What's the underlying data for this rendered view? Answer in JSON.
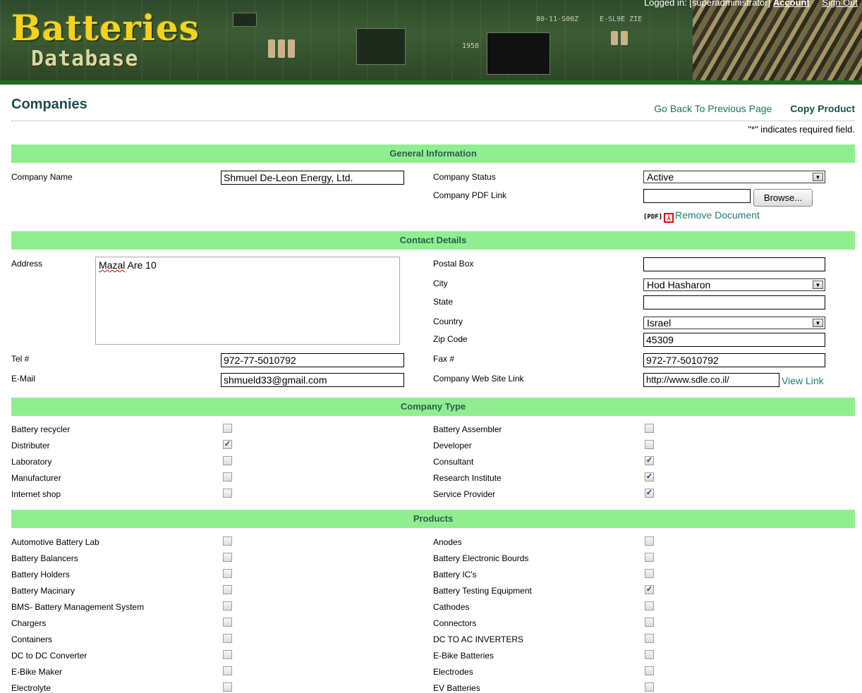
{
  "header": {
    "logo_line1": "Batteries",
    "logo_line2": "Database",
    "logged_in_text": "Logged in: [superadministrator]",
    "account_link": "Account",
    "signout_link": "Sign Out"
  },
  "page": {
    "title": "Companies",
    "back_link": "Go Back To Previous Page",
    "copy_link": "Copy Product",
    "required_note": "\"*\" indicates required field."
  },
  "general": {
    "heading": "General Information",
    "company_name_label": "Company Name",
    "company_name_value": "Shmuel De-Leon Energy, Ltd.",
    "status_label": "Company Status",
    "status_value": "Active",
    "pdf_label": "Company PDF Link",
    "browse_label": "Browse...",
    "pdf_tag": "[PDF]",
    "remove_doc": "Remove Document"
  },
  "contact": {
    "heading": "Contact Details",
    "address_label": "Address",
    "address_word1": "Mazal",
    "address_rest": " Are 10",
    "postal_label": "Postal Box",
    "postal_value": "",
    "city_label": "City",
    "city_value": "Hod Hasharon",
    "state_label": "State",
    "state_value": "",
    "country_label": "Country",
    "country_value": "Israel",
    "zip_label": "Zip Code",
    "zip_value": "45309",
    "tel_label": "Tel #",
    "tel_value": "972-77-5010792",
    "fax_label": "Fax #",
    "fax_value": "972-77-5010792",
    "email_label": "E-Mail",
    "email_value": "shmueld33@gmail.com",
    "web_label": "Company Web Site Link",
    "web_value": "http://www.sdle.co.il/",
    "view_link": "View Link"
  },
  "company_type": {
    "heading": "Company Type",
    "left": [
      {
        "label": "Battery recycler",
        "checked": false
      },
      {
        "label": "Distributer",
        "checked": true
      },
      {
        "label": "Laboratory",
        "checked": false
      },
      {
        "label": "Manufacturer",
        "checked": false
      },
      {
        "label": "Internet shop",
        "checked": false
      }
    ],
    "right": [
      {
        "label": "Battery Assembler",
        "checked": false
      },
      {
        "label": "Developer",
        "checked": false
      },
      {
        "label": "Consultant",
        "checked": true
      },
      {
        "label": "Research Institute",
        "checked": true
      },
      {
        "label": "Service Provider",
        "checked": true
      }
    ]
  },
  "products": {
    "heading": "Products",
    "left": [
      {
        "label": "Automotive Battery Lab",
        "checked": false
      },
      {
        "label": "Battery Balancers",
        "checked": false
      },
      {
        "label": "Battery Holders",
        "checked": false
      },
      {
        "label": "Battery Macinary",
        "checked": false
      },
      {
        "label": "BMS- Battery Management System",
        "checked": false
      },
      {
        "label": "Chargers",
        "checked": false
      },
      {
        "label": "Containers",
        "checked": false
      },
      {
        "label": "DC to DC Converter",
        "checked": false
      },
      {
        "label": "E-Bike Maker",
        "checked": false
      },
      {
        "label": "Electrolyte",
        "checked": false
      }
    ],
    "right": [
      {
        "label": "Anodes",
        "checked": false
      },
      {
        "label": "Battery Electronic Bourds",
        "checked": false
      },
      {
        "label": "Battery IC's",
        "checked": false
      },
      {
        "label": "Battery Testing Equipment",
        "checked": true
      },
      {
        "label": "Cathodes",
        "checked": false
      },
      {
        "label": "Connectors",
        "checked": false
      },
      {
        "label": "DC TO AC INVERTERS",
        "checked": false
      },
      {
        "label": "E-Bike Batteries",
        "checked": false
      },
      {
        "label": "Electrodes",
        "checked": false
      },
      {
        "label": "EV Batteries",
        "checked": false
      }
    ]
  },
  "colors": {
    "section_bg": "#90ee90",
    "title_color": "#1f4f4a",
    "link_color": "#1f7f6f",
    "logo_color": "#f4d21e"
  }
}
